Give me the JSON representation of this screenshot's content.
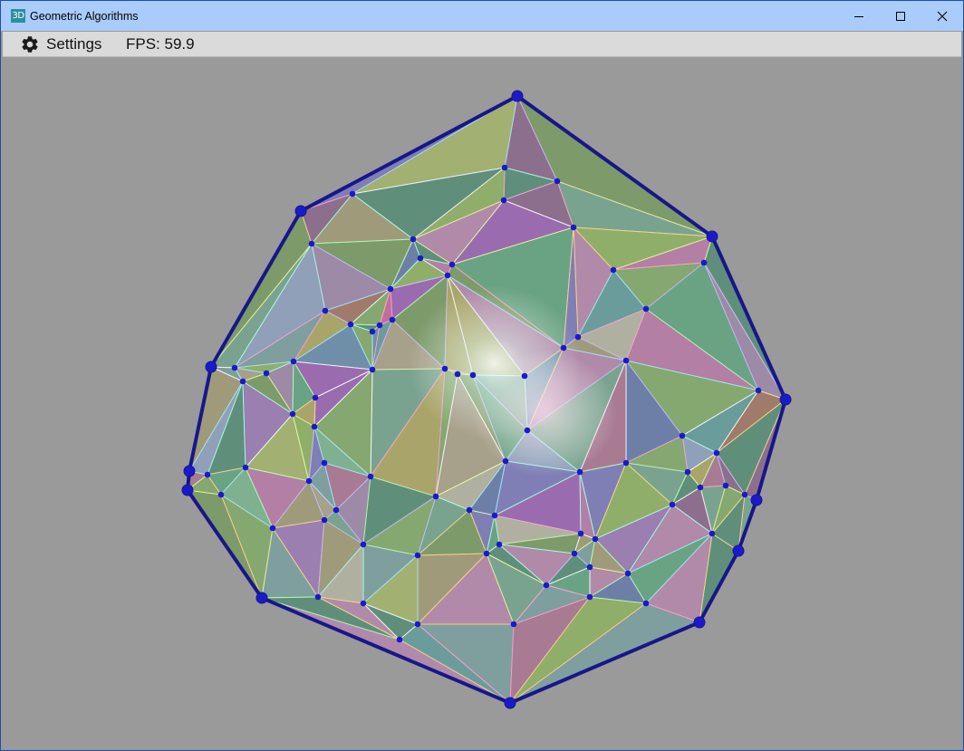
{
  "window": {
    "title": "Geometric Algorithms",
    "icon_name": "app-3d-icon",
    "icon_text": "3D",
    "controls": [
      "minimize-icon",
      "maximize-icon",
      "close-icon"
    ]
  },
  "menubar": {
    "settings_label": "Settings",
    "settings_icon": "gear-icon",
    "fps_label": "FPS: 59.9"
  },
  "colors": {
    "background": "#9a9a9a",
    "hull_edge": "#17178a",
    "vertex": "#1a1acd",
    "titlebar": "#a9ccfb",
    "menubar": "#dadada"
  }
}
